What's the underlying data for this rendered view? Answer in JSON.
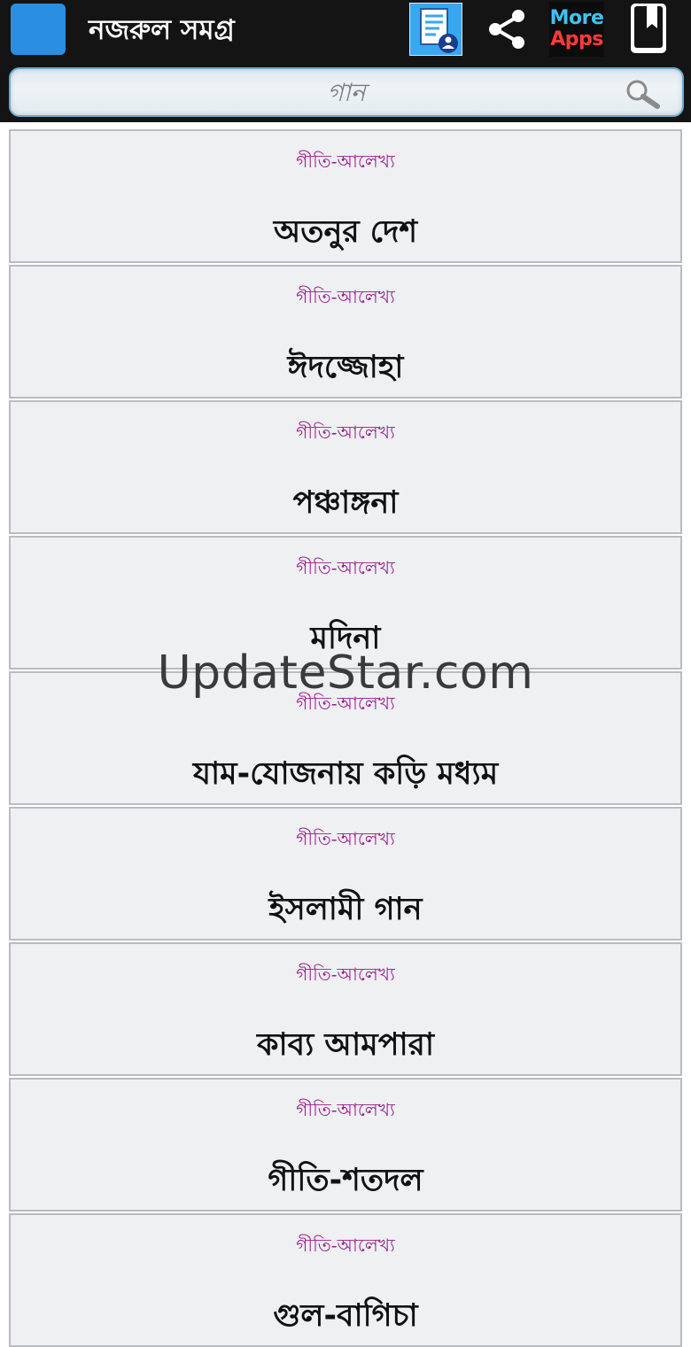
{
  "app": {
    "title": "নজরুল সমগ্র"
  },
  "toolbar": {
    "doc_icon": "contact-document-icon",
    "share_icon": "share-icon",
    "more_apps": {
      "line1": "More",
      "line2": "Apps"
    },
    "bookmark_icon": "bookmark-book-icon"
  },
  "search": {
    "placeholder": "গান",
    "icon": "search-icon"
  },
  "list": {
    "items": [
      {
        "category": "গীতি-আলেখ্য",
        "title": "অতনুর দেশ"
      },
      {
        "category": "গীতি-আলেখ্য",
        "title": "ঈদজ্জোহা"
      },
      {
        "category": "গীতি-আলেখ্য",
        "title": "পঞ্চাঙ্গনা"
      },
      {
        "category": "গীতি-আলেখ্য",
        "title": "মদিনা"
      },
      {
        "category": "গীতি-আলেখ্য",
        "title": "যাম-যোজনায় কড়ি মধ্যম"
      },
      {
        "category": "গীতি-আলেখ্য",
        "title": "ইসলামী গান"
      },
      {
        "category": "গীতি-আলেখ্য",
        "title": "কাব্য আমপারা"
      },
      {
        "category": "গীতি-আলেখ্য",
        "title": "গীতি-শতদল"
      },
      {
        "category": "গীতি-আলেখ্য",
        "title": "গুল-বাগিচা"
      }
    ]
  },
  "watermark": "UpdateStar.com",
  "colors": {
    "toolbar_bg": "#141414",
    "app_icon": "#2a8fe3",
    "category_text": "#9b1b8c",
    "item_bg": "#eef0f2",
    "more_blue": "#3ec2f5",
    "more_red": "#ff3a3a"
  }
}
